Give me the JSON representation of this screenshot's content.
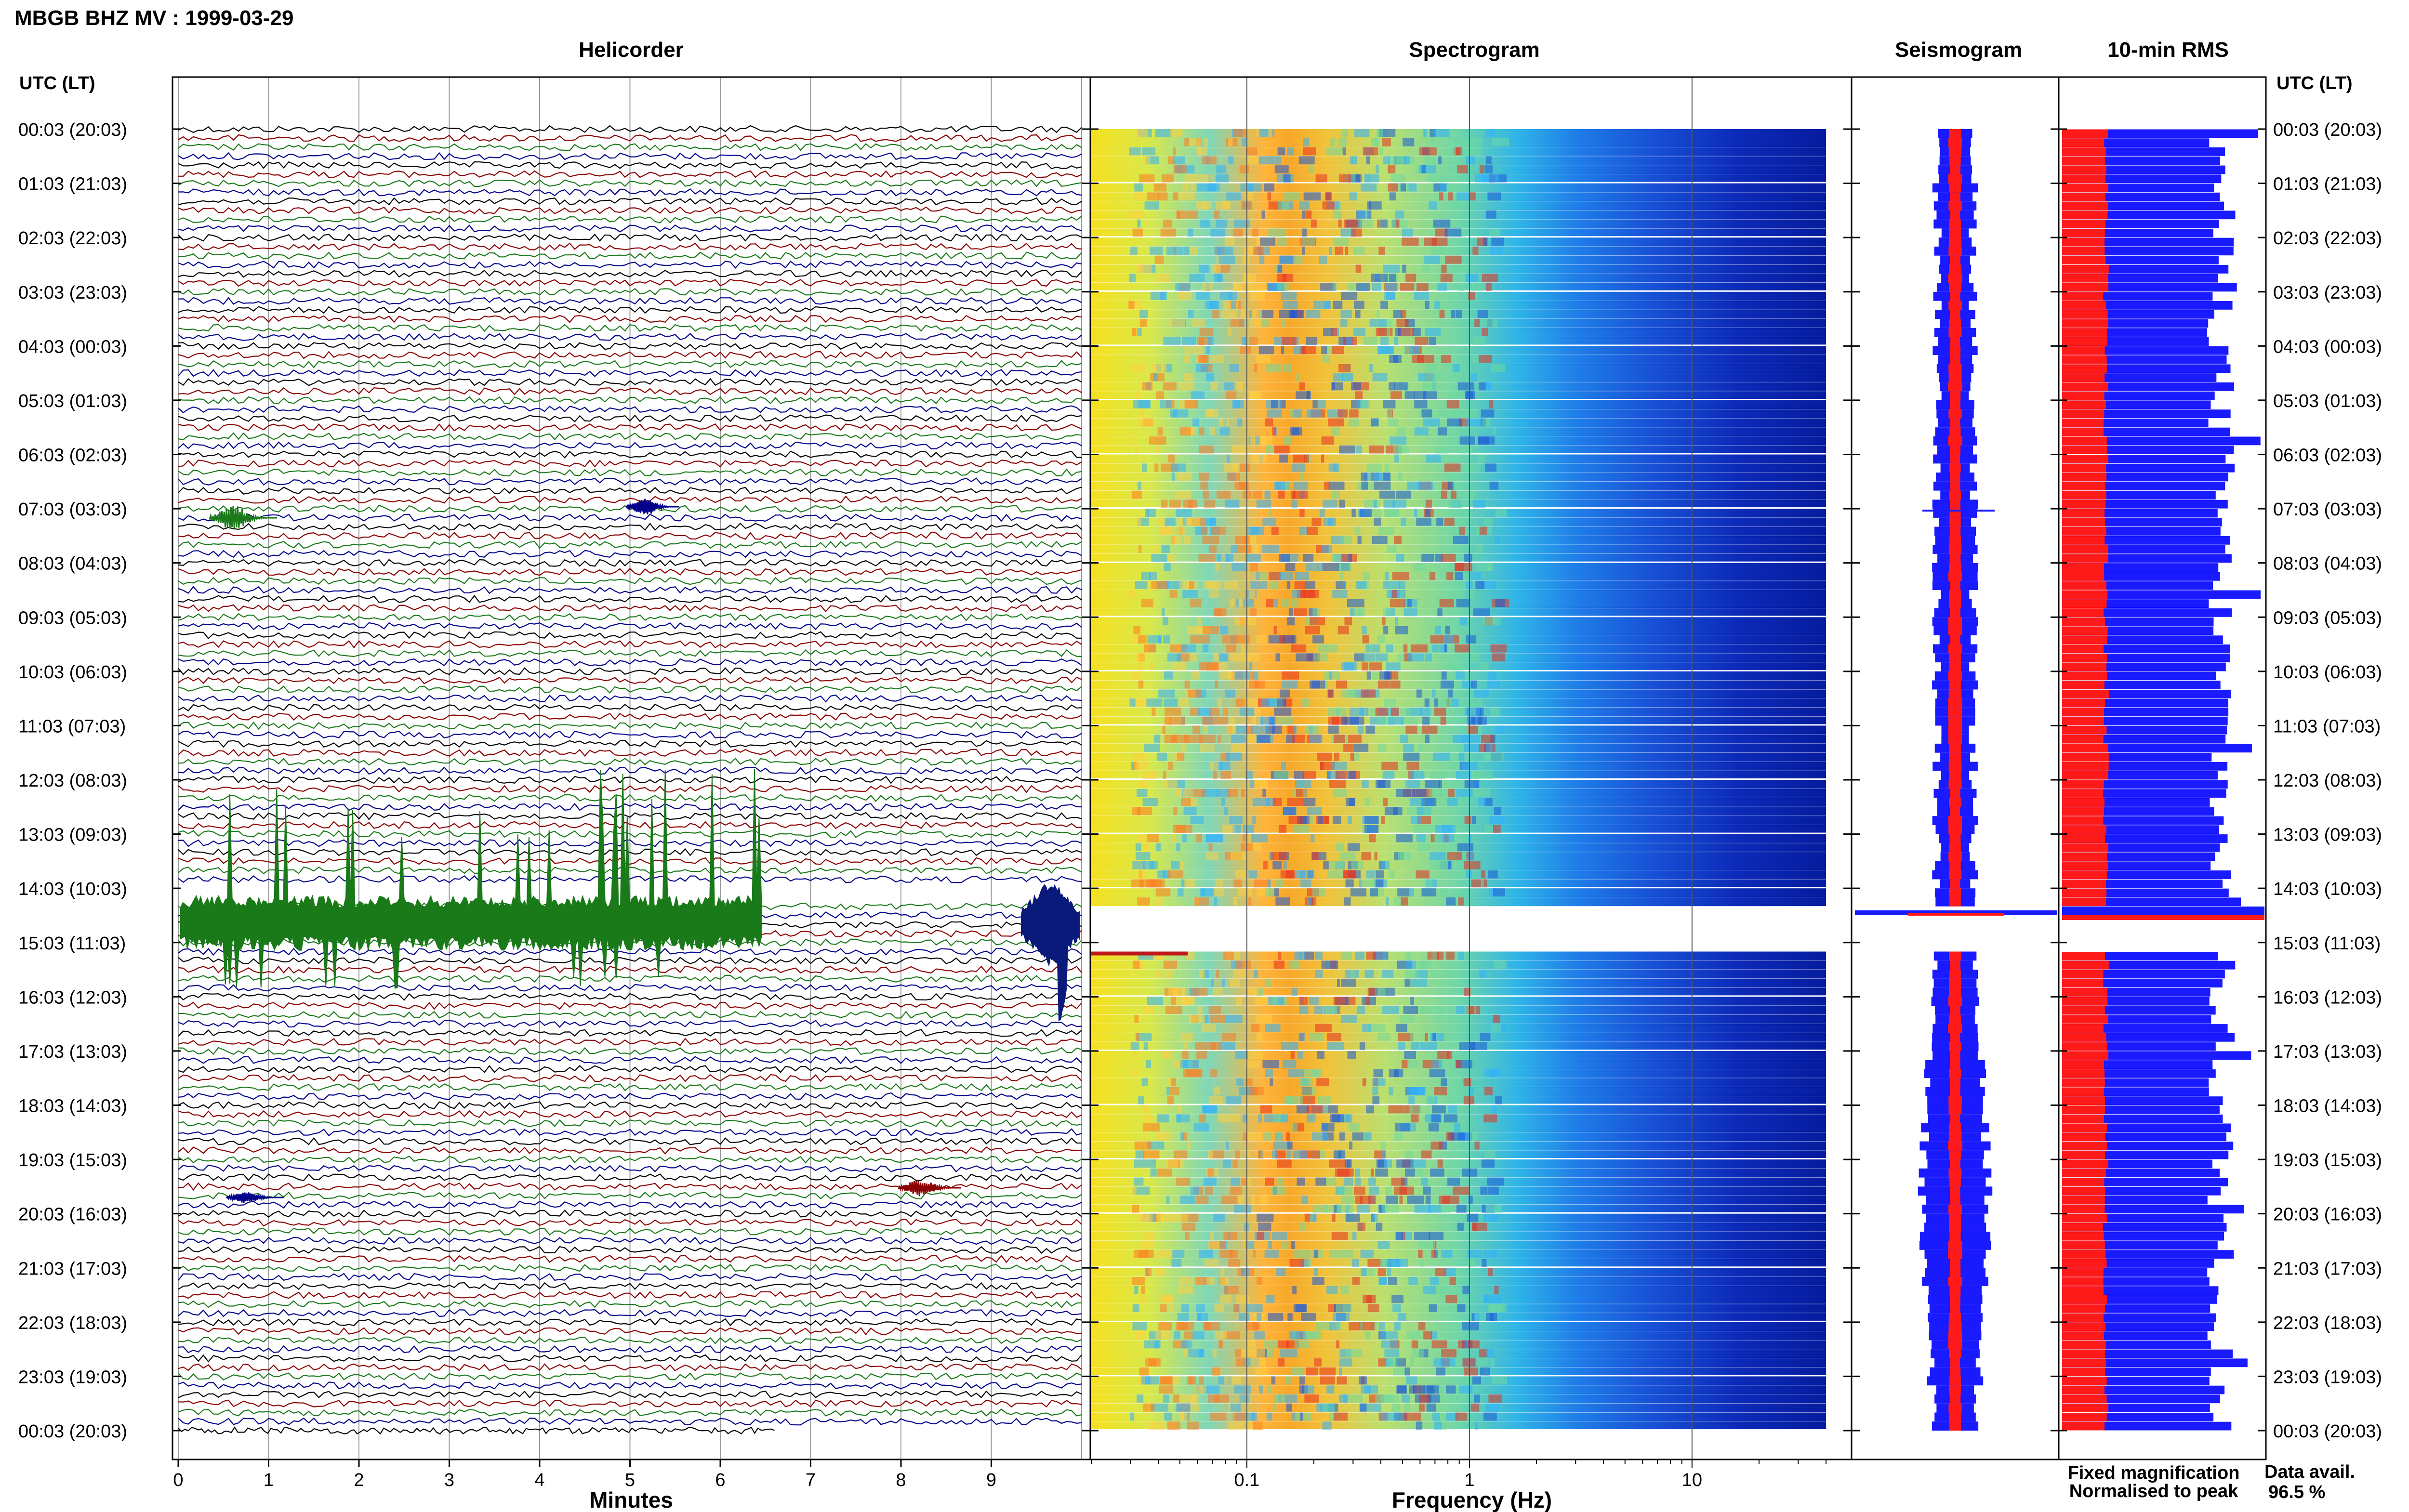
{
  "header": {
    "title": "MBGB BHZ MV : 1999-03-29"
  },
  "panels": {
    "helicorder": {
      "title": "Helicorder",
      "xlabel": "Minutes"
    },
    "spectrogram": {
      "title": "Spectrogram",
      "xlabel": "Frequency (Hz)"
    },
    "seismogram": {
      "title": "Seismogram"
    },
    "rms": {
      "title": "10-min RMS"
    }
  },
  "axis": {
    "left_header": "UTC (LT)",
    "right_header": "UTC (LT)",
    "time_labels": [
      "00:03 (20:03)",
      "01:03 (21:03)",
      "02:03 (22:03)",
      "03:03 (23:03)",
      "04:03 (00:03)",
      "05:03 (01:03)",
      "06:03 (02:03)",
      "07:03 (03:03)",
      "08:03 (04:03)",
      "09:03 (05:03)",
      "10:03 (06:03)",
      "11:03 (07:03)",
      "12:03 (08:03)",
      "13:03 (09:03)",
      "14:03 (10:03)",
      "15:03 (11:03)",
      "16:03 (12:03)",
      "17:03 (13:03)",
      "18:03 (14:03)",
      "19:03 (15:03)",
      "20:03 (16:03)",
      "21:03 (17:03)",
      "22:03 (18:03)",
      "23:03 (19:03)",
      "00:03 (20:03)"
    ],
    "minute_ticks": [
      "0",
      "1",
      "2",
      "3",
      "4",
      "5",
      "6",
      "7",
      "8",
      "9"
    ],
    "freq_ticks": [
      "0.1",
      "1",
      "10"
    ]
  },
  "legend": {
    "fixed": "Fixed magnification",
    "normalised": "Normalised to peak",
    "fixed_color": "#1a1aff",
    "normalised_color": "#ff1a1a"
  },
  "availability": {
    "label": "Data avail.",
    "value": "96.5 %"
  },
  "chart_data": {
    "type": "heatmap",
    "title": "MBGB BHZ MV : 1999-03-29",
    "helicorder_minutes": [
      0,
      10
    ],
    "spectrogram_freq_range_hz": [
      0.02,
      40
    ],
    "spectrogram_freq_scale": "log",
    "time_range_utc": [
      "00:03",
      "00:03 (+1 day)"
    ],
    "data_gap_utc": [
      "14:03",
      "14:20"
    ],
    "rms_bands": {
      "fixed_magnification_color": "#0000ff",
      "normalised_to_peak_color": "#ff0000"
    },
    "trace_colors": [
      "#000000",
      "#8b0000",
      "#1a7a1a",
      "#00008b"
    ],
    "data_availability_percent": 96.5
  }
}
